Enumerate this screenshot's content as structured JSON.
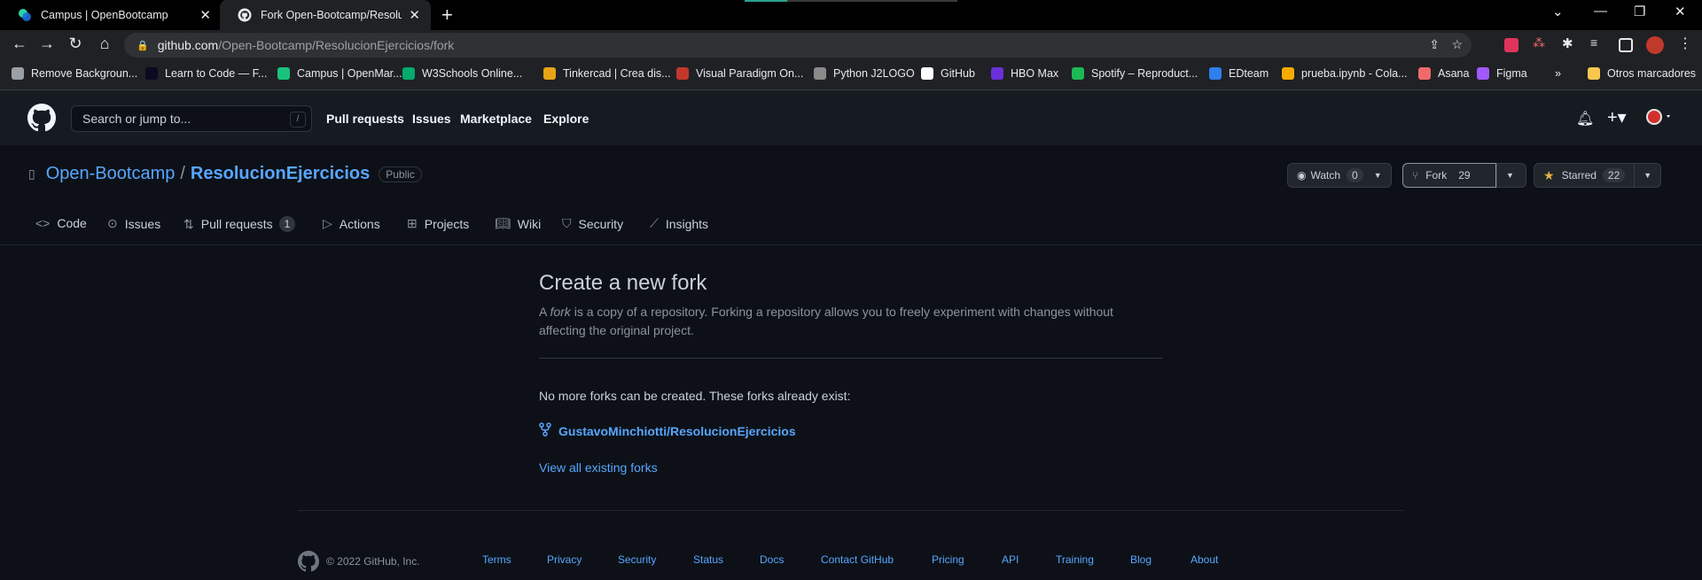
{
  "browser": {
    "tabs": [
      {
        "title": "Campus | OpenBootcamp",
        "favicon": "openbootcamp-icon",
        "close": "✕"
      },
      {
        "title": "Fork Open-Bootcamp/Resolucion",
        "favicon": "github-icon",
        "close": "✕"
      }
    ],
    "new_tab": "+",
    "url_host": "github.com",
    "url_path": "/Open-Bootcamp/ResolucionEjercicios/fork",
    "bookmarks": [
      {
        "label": "Remove Backgroun...",
        "color": "#9aa0a6"
      },
      {
        "label": "Learn to Code — F...",
        "color": "#0a0a23"
      },
      {
        "label": "Campus | OpenMar...",
        "color": "#19c37d"
      },
      {
        "label": "W3Schools Online...",
        "color": "#04aa6d"
      },
      {
        "label": "Tinkercad | Crea dis...",
        "color": "#e8a317"
      },
      {
        "label": "Visual Paradigm On...",
        "color": "#c0392b"
      },
      {
        "label": "Python J2LOGO",
        "color": "#8a8a8a"
      },
      {
        "label": "GitHub",
        "color": "#ffffff"
      },
      {
        "label": "HBO Max",
        "color": "#6a30d9"
      },
      {
        "label": "Spotify – Reproduct...",
        "color": "#1db954"
      },
      {
        "label": "EDteam",
        "color": "#2f80ed"
      },
      {
        "label": "prueba.ipynb - Cola...",
        "color": "#f9ab00"
      },
      {
        "label": "Asana",
        "color": "#f06a6a"
      },
      {
        "label": "Figma",
        "color": "#a259ff"
      }
    ],
    "bookmarks_more": "»",
    "other_bookmarks": "Otros marcadores"
  },
  "header": {
    "search_placeholder": "Search or jump to...",
    "search_key": "/",
    "nav": [
      "Pull requests",
      "Issues",
      "Marketplace",
      "Explore"
    ]
  },
  "repo": {
    "owner": "Open-Bootcamp",
    "separator": "/",
    "name": "ResolucionEjercicios",
    "visibility": "Public",
    "watch": {
      "label": "Watch",
      "count": "0"
    },
    "fork": {
      "label": "Fork",
      "count": "29"
    },
    "star": {
      "label": "Starred",
      "count": "22"
    },
    "tabs": [
      {
        "label": "Code",
        "icon": "code-icon"
      },
      {
        "label": "Issues",
        "icon": "issue-icon"
      },
      {
        "label": "Pull requests",
        "icon": "pull-request-icon",
        "count": "1"
      },
      {
        "label": "Actions",
        "icon": "play-icon"
      },
      {
        "label": "Projects",
        "icon": "table-icon"
      },
      {
        "label": "Wiki",
        "icon": "book-icon"
      },
      {
        "label": "Security",
        "icon": "shield-icon"
      },
      {
        "label": "Insights",
        "icon": "graph-icon"
      }
    ]
  },
  "main": {
    "title": "Create a new fork",
    "desc_prefix": "A ",
    "desc_em": "fork",
    "desc_rest": " is a copy of a repository. Forking a repository allows you to freely experiment with changes without affecting the original project.",
    "notice": "No more forks can be created. These forks already exist:",
    "existing_fork": "GustavoMinchiotti/ResolucionEjercicios",
    "view_all": "View all existing forks"
  },
  "footer": {
    "copyright": "© 2022 GitHub, Inc.",
    "links": [
      "Terms",
      "Privacy",
      "Security",
      "Status",
      "Docs",
      "Contact GitHub",
      "Pricing",
      "API",
      "Training",
      "Blog",
      "About"
    ]
  },
  "colors": {
    "link": "#58a6ff",
    "bg": "#0d1117",
    "header": "#161b22"
  }
}
